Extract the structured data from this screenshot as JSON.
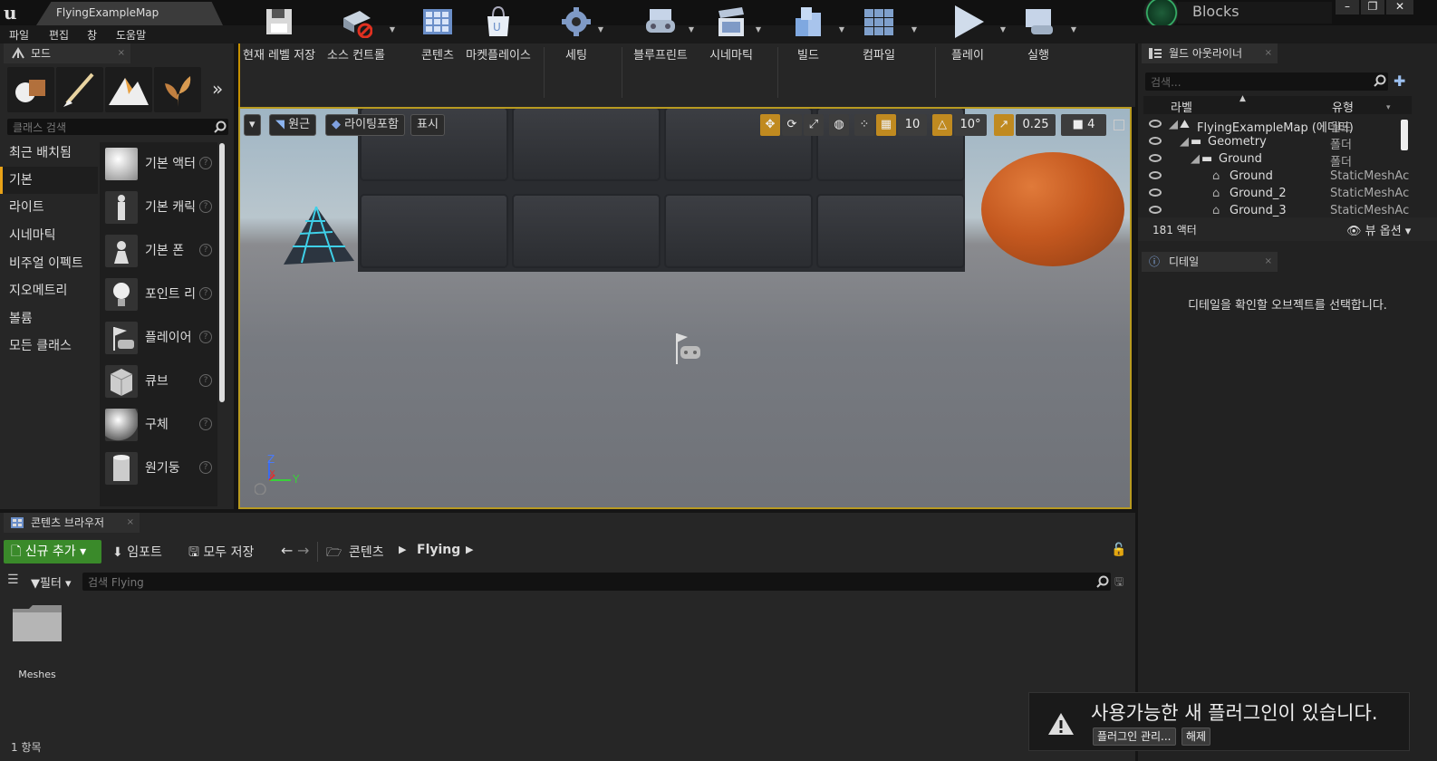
{
  "window": {
    "doc_tab": "FlyingExampleMap",
    "project": "Blocks [DebugGame]",
    "minimize": "–",
    "maximize": "❐",
    "close": "✕"
  },
  "menu": [
    "파일",
    "편집",
    "창",
    "도움말"
  ],
  "modes": {
    "tab": "모드",
    "more": "»",
    "search_placeholder": "클래스 검색",
    "categories": [
      "최근 배치됨",
      "기본",
      "라이트",
      "시네마틱",
      "비주얼 이펙트",
      "지오메트리",
      "볼륨",
      "모든 클래스"
    ],
    "actors": [
      "기본 액터",
      "기본 캐릭",
      "기본 폰",
      "포인트 리",
      "플레이어",
      "큐브",
      "구체",
      "원기둥"
    ]
  },
  "toolbar": [
    "현재 레벨 저장",
    "소스 컨트롤",
    "콘텐츠",
    "마켓플레이스",
    "세팅",
    "블루프린트",
    "시네마틱",
    "빌드",
    "컴파일",
    "플레이",
    "실행"
  ],
  "viewport": {
    "perspective": "원근",
    "lighting": "라이팅포함",
    "show": "표시",
    "grid_snap": "10",
    "rot_snap": "10°",
    "scale_snap": "0.25",
    "cam_speed": "4",
    "axis_x": "X",
    "axis_y": "Y",
    "axis_z": "Z"
  },
  "outliner": {
    "tab": "월드 아웃라이너",
    "search_placeholder": "검색...",
    "col_label": "라벨",
    "col_type": "유형",
    "rows": [
      {
        "name": "FlyingExampleMap (에디터)",
        "type": "월드"
      },
      {
        "name": "Geometry",
        "type": "폴더"
      },
      {
        "name": "Ground",
        "type": "폴더"
      },
      {
        "name": "Ground",
        "type": "StaticMeshAc"
      },
      {
        "name": "Ground_2",
        "type": "StaticMeshAc"
      },
      {
        "name": "Ground_3",
        "type": "StaticMeshAc"
      }
    ],
    "count": "181 액터",
    "view_options": "뷰 옵션"
  },
  "details": {
    "tab": "디테일",
    "hint": "디테일을 확인할 오브젝트를 선택합니다."
  },
  "content_browser": {
    "tab": "콘텐츠 브라우저",
    "add_new": "신규 추가",
    "import": "임포트",
    "save_all": "모두 저장",
    "path_root": "콘텐츠",
    "path_current": "Flying",
    "filter": "필터",
    "search_placeholder": "검색 Flying",
    "folder": "Meshes",
    "item_count": "1 항목"
  },
  "toast": {
    "message": "사용가능한 새 플러그인이 있습니다.",
    "manage": "플러그인 관리...",
    "dismiss": "해제"
  }
}
